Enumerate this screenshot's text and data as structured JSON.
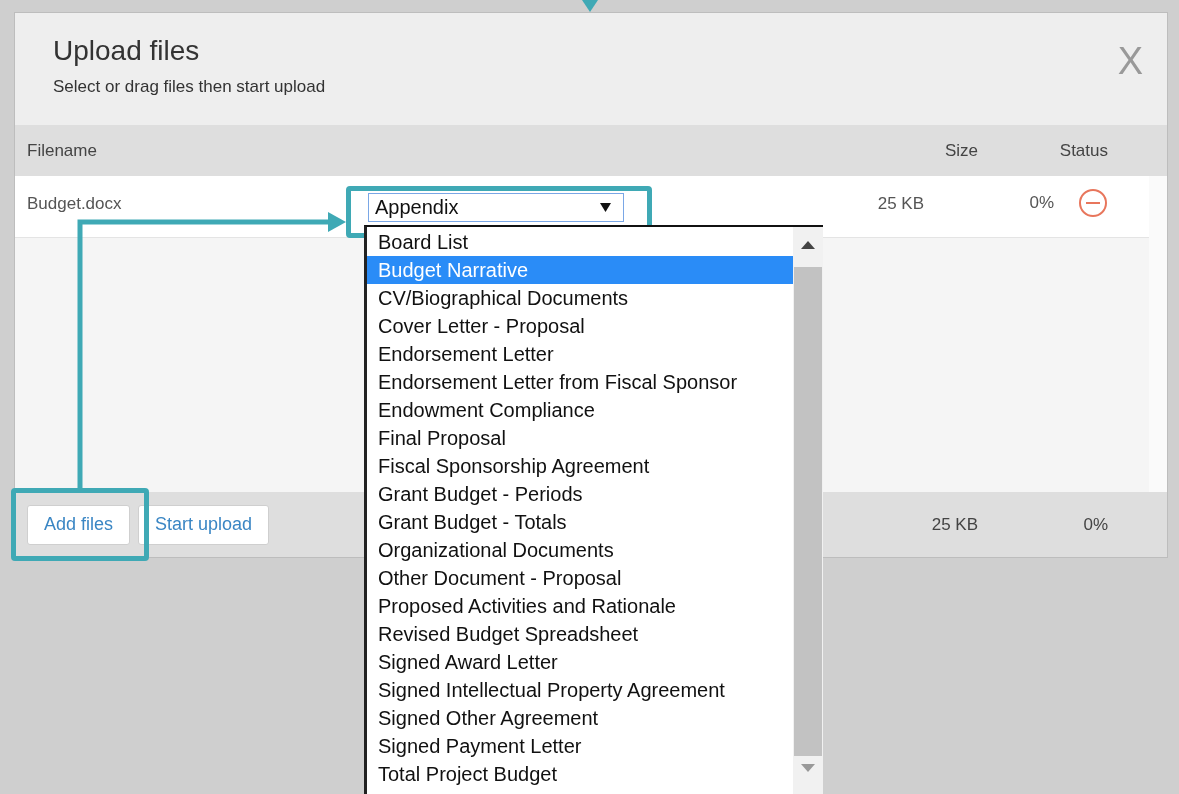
{
  "dialog": {
    "title": "Upload files",
    "subtitle": "Select or drag files then start upload",
    "close_label": "X"
  },
  "table": {
    "columns": [
      "Filename",
      "Size",
      "Status"
    ],
    "rows": [
      {
        "filename": "Budget.docx",
        "category": "Appendix",
        "size": "25 KB",
        "progress": "0%"
      }
    ]
  },
  "dropdown": {
    "options": [
      {
        "label": "Board List",
        "selected": false
      },
      {
        "label": "Budget Narrative",
        "selected": true
      },
      {
        "label": "CV/Biographical Documents",
        "selected": false
      },
      {
        "label": "Cover Letter - Proposal",
        "selected": false
      },
      {
        "label": "Endorsement Letter",
        "selected": false
      },
      {
        "label": "Endorsement Letter from Fiscal Sponsor",
        "selected": false
      },
      {
        "label": "Endowment Compliance",
        "selected": false
      },
      {
        "label": "Final Proposal",
        "selected": false
      },
      {
        "label": "Fiscal Sponsorship Agreement",
        "selected": false
      },
      {
        "label": "Grant Budget - Periods",
        "selected": false
      },
      {
        "label": "Grant Budget - Totals",
        "selected": false
      },
      {
        "label": "Organizational Documents",
        "selected": false
      },
      {
        "label": "Other Document - Proposal",
        "selected": false
      },
      {
        "label": "Proposed Activities and Rationale",
        "selected": false
      },
      {
        "label": "Revised Budget Spreadsheet",
        "selected": false
      },
      {
        "label": "Signed Award Letter",
        "selected": false
      },
      {
        "label": "Signed Intellectual Property Agreement",
        "selected": false
      },
      {
        "label": "Signed Other Agreement",
        "selected": false
      },
      {
        "label": "Signed Payment Letter",
        "selected": false
      },
      {
        "label": "Total Project Budget",
        "selected": false
      }
    ]
  },
  "footer": {
    "buttons": [
      "Add files",
      "Start upload"
    ],
    "total_size": "25 KB",
    "total_progress": "0%"
  }
}
